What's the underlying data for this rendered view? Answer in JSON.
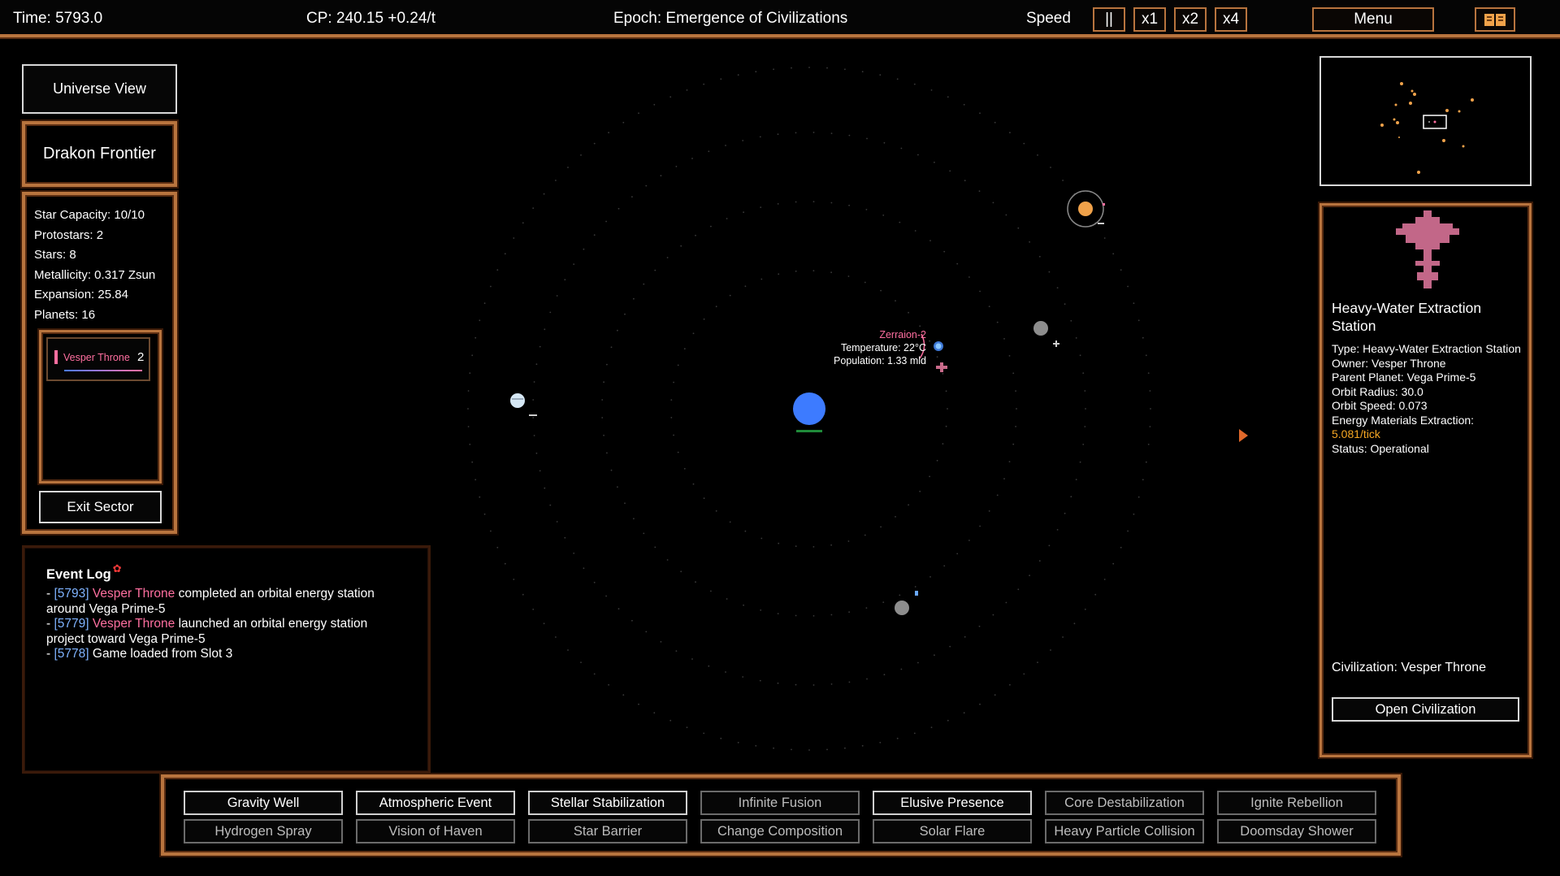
{
  "topbar": {
    "time": "Time: 5793.0",
    "cp": "CP: 240.15 +0.24/t",
    "epoch": "Epoch: Emergence of Civilizations",
    "speed_label": "Speed",
    "pause_label": "||",
    "x1_label": "x1",
    "x2_label": "x2",
    "x4_label": "x4",
    "menu_label": "Menu",
    "book_icon": "book-icon"
  },
  "left": {
    "universe_view_label": "Universe View",
    "sector_title": "Drakon Frontier",
    "stats": [
      "Star Capacity: 10/10",
      "Protostars: 2",
      "Stars: 8",
      "Metallicity: 0.317 Zsun",
      "Expansion: 25.84",
      "Planets: 16"
    ],
    "civ_entry": {
      "name": "Vesper Throne",
      "count": "2",
      "color": "#ff6fa0"
    },
    "exit_label": "Exit Sector"
  },
  "event_log": {
    "title": "Event Log",
    "entries": [
      {
        "prefix": "- ",
        "time": "[5793]",
        "civ": "Vesper Throne",
        "text": " completed an orbital energy station around Vega Prime-5"
      },
      {
        "prefix": "- ",
        "time": "[5779]",
        "civ": "Vesper Throne",
        "text": " launched an orbital energy station project toward Vega Prime-5"
      },
      {
        "prefix": "- ",
        "time": "[5778]",
        "civ": "",
        "text": " Game loaded from Slot 3"
      }
    ]
  },
  "map": {
    "planet_label": {
      "name": "Zerraion-2",
      "temperature": "Temperature: 22°C",
      "population": "Population: 1.33 mld"
    }
  },
  "info": {
    "title": "Heavy-Water Extraction Station",
    "lines": [
      "Type: Heavy-Water Extraction Station",
      "Owner: Vesper Throne",
      "Parent Planet: Vega Prime-5",
      "Orbit Radius: 30.0",
      "Orbit Speed: 0.073",
      "Energy Materials Extraction:"
    ],
    "extraction_value": "5.081/tick",
    "status": "Status: Operational",
    "civilization": "Civilization: Vesper Throne",
    "open_civ_label": "Open Civilization"
  },
  "abilities": {
    "row1": [
      {
        "label": "Gravity Well",
        "enabled": true
      },
      {
        "label": "Atmospheric Event",
        "enabled": true
      },
      {
        "label": "Stellar Stabilization",
        "enabled": true
      },
      {
        "label": "Infinite Fusion",
        "enabled": false
      },
      {
        "label": "Elusive Presence",
        "enabled": true
      },
      {
        "label": "Core Destabilization",
        "enabled": false
      },
      {
        "label": "Ignite Rebellion",
        "enabled": false
      }
    ],
    "row2": [
      {
        "label": "Hydrogen Spray",
        "enabled": false
      },
      {
        "label": "Vision of Haven",
        "enabled": false
      },
      {
        "label": "Star Barrier",
        "enabled": false
      },
      {
        "label": "Change Composition",
        "enabled": false
      },
      {
        "label": "Solar Flare",
        "enabled": false
      },
      {
        "label": "Heavy Particle Collision",
        "enabled": false
      },
      {
        "label": "Doomsday Shower",
        "enabled": false
      }
    ]
  },
  "colors": {
    "frame": "#b8743e",
    "civ": "#ff6fa0",
    "time": "#7fb3ff",
    "highlight": "#f5a623",
    "star": "#3d7bff"
  }
}
